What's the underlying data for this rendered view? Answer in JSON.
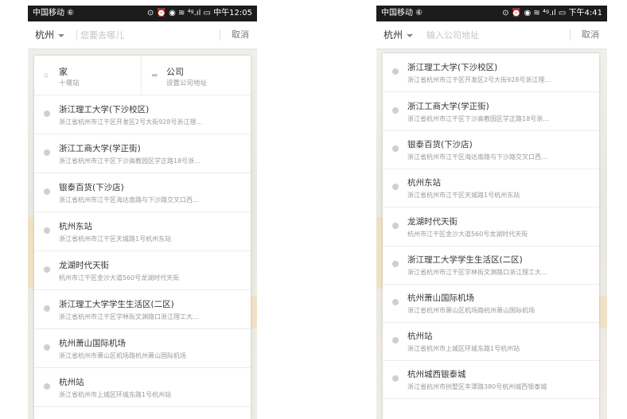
{
  "left": {
    "status": {
      "carrier": "中国移动 ⑥",
      "right": "⊙ ⏰ ◉ ≋ ⁴ᵍ.ıl ▭ 中午12:05"
    },
    "search": {
      "city": "杭州",
      "placeholder": "您要去哪儿",
      "cancel": "取消"
    },
    "quick": {
      "home": {
        "title": "家",
        "sub": "十堰站",
        "icon": "⌂"
      },
      "company": {
        "title": "公司",
        "sub": "设置公司地址",
        "icon": "▬"
      }
    },
    "items": [
      {
        "title": "浙江理工大学(下沙校区)",
        "addr": "浙江省杭州市江干区开发区2号大街928号浙江理…"
      },
      {
        "title": "浙江工商大学(学正街)",
        "addr": "浙江省杭州市江干区下沙高教园区学正路18号浙…"
      },
      {
        "title": "银泰百货(下沙店)",
        "addr": "浙江省杭州市江干区海达南路与下沙路交叉口西…"
      },
      {
        "title": "杭州东站",
        "addr": "浙江省杭州市江干区天城路1号杭州东站"
      },
      {
        "title": "龙湖时代天街",
        "addr": "杭州市江干区金沙大道560号龙湖时代天街"
      },
      {
        "title": "浙江理工大学学生生活区(二区)",
        "addr": "浙江省杭州市江干区学林街文渊路口浙江理工大…"
      },
      {
        "title": "杭州萧山国际机场",
        "addr": "浙江省杭州市萧山区机场路杭州萧山国际机场"
      },
      {
        "title": "杭州站",
        "addr": "浙江省杭州市上城区环城东路1号杭州站"
      }
    ]
  },
  "right": {
    "status": {
      "carrier": "中国移动 ⑥",
      "right": "⊙ ⏰ ◉ ≋ ⁴ᵍ.ıl ▭ 下午4:41"
    },
    "search": {
      "city": "杭州",
      "placeholder": "输入公司地址",
      "cancel": "取消"
    },
    "items": [
      {
        "title": "浙江理工大学(下沙校区)",
        "addr": "浙江省杭州市江干区开发区2号大街928号浙江理…"
      },
      {
        "title": "浙江工商大学(学正街)",
        "addr": "浙江省杭州市江干区下沙高教园区学正路18号浙…"
      },
      {
        "title": "银泰百货(下沙店)",
        "addr": "浙江省杭州市江干区海达南路与下沙路交叉口西…"
      },
      {
        "title": "杭州东站",
        "addr": "浙江省杭州市江干区天城路1号杭州东站"
      },
      {
        "title": "龙湖时代天街",
        "addr": "杭州市江干区金沙大道560号龙湖时代天街"
      },
      {
        "title": "浙江理工大学学生生活区(二区)",
        "addr": "浙江省杭州市江干区学林街文渊路口浙江理工大…"
      },
      {
        "title": "杭州萧山国际机场",
        "addr": "浙江省杭州市萧山区机场路杭州萧山国际机场"
      },
      {
        "title": "杭州站",
        "addr": "浙江省杭州市上城区环城东路1号杭州站"
      },
      {
        "title": "杭州城西银泰城",
        "addr": "浙江省杭州市拱墅区丰潭路380号杭州城西银泰城"
      }
    ]
  },
  "colors": {
    "status_bar": "#1c1c1c",
    "pin": "#cfcfcf",
    "divider": "#ececec",
    "placeholder": "#c4c4c4"
  }
}
